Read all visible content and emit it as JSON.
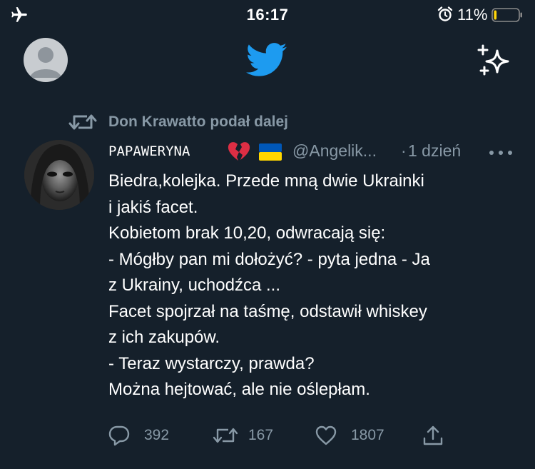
{
  "status_bar": {
    "time": "16:17",
    "battery_percent": "11%",
    "battery_level": 0.11,
    "icons": [
      "airplane-icon",
      "alarm-icon",
      "battery-icon"
    ]
  },
  "header": {
    "icons": [
      "avatar",
      "twitter-logo-icon",
      "sparkle-icon"
    ]
  },
  "retweet": {
    "label": "Don Krawatto podał dalej"
  },
  "tweet": {
    "display_name": "PAPAWERYNA",
    "name_emojis": [
      "broken-heart-emoji",
      "ukraine-flag-emoji"
    ],
    "handle": "@Angelik...",
    "separator": "·",
    "time_ago": "1 dzień",
    "text_lines": [
      "Biedra,kolejka. Przede mną dwie Ukrainki",
      "i jakiś facet.",
      "Kobietom brak 10,20, odwracają się:",
      "- Mógłby pan mi dołożyć? - pyta jedna - Ja",
      "z Ukrainy, uchodźca ...",
      "Facet spojrzał na taśmę, odstawił whiskey",
      "z ich zakupów.",
      "- Teraz wystarczy, prawda?",
      "Można hejtować, ale nie oślepłam."
    ],
    "actions": {
      "replies": "392",
      "retweets": "167",
      "likes": "1807"
    }
  },
  "colors": {
    "background": "#15202b",
    "text": "#ffffff",
    "secondary": "#8899a6",
    "twitter_blue": "#1d9bf0",
    "heart_red": "#dd2e44",
    "battery_yellow": "#ffd60a"
  }
}
